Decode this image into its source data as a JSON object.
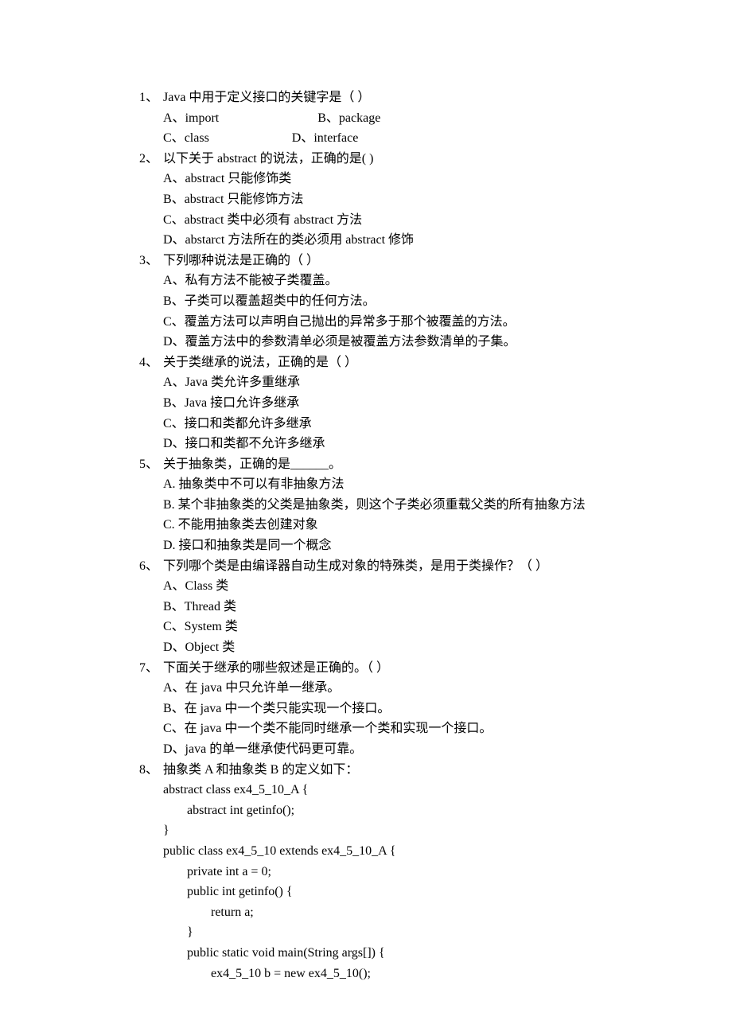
{
  "questions": [
    {
      "num": "1、",
      "stem": "Java 中用于定义接口的关键字是（          ）",
      "optLines": [
        [
          {
            "label": "A、",
            "text": "import",
            "pad": 170
          },
          {
            "label": "B、",
            "text": "package",
            "pad": 0
          }
        ],
        [
          {
            "label": "C、",
            "text": "class",
            "pad": 130
          },
          {
            "label": "D、",
            "text": "interface",
            "pad": 0
          }
        ]
      ]
    },
    {
      "num": "2、",
      "stem": "以下关于 abstract 的说法，正确的是(           )",
      "options": [
        "A、abstract 只能修饰类",
        "B、abstract 只能修饰方法",
        "C、abstract 类中必须有 abstract 方法",
        "D、abstarct 方法所在的类必须用 abstract 修饰"
      ]
    },
    {
      "num": "3、",
      "stem": "下列哪种说法是正确的（          ）",
      "options": [
        "A、私有方法不能被子类覆盖。",
        "B、子类可以覆盖超类中的任何方法。",
        "C、覆盖方法可以声明自己抛出的异常多于那个被覆盖的方法。",
        "D、覆盖方法中的参数清单必须是被覆盖方法参数清单的子集。"
      ]
    },
    {
      "num": "4、",
      "stem": "关于类继承的说法，正确的是（         ）",
      "options": [
        "A、Java  类允许多重继承",
        "B、Java 接口允许多继承",
        "C、接口和类都允许多继承",
        "D、接口和类都不允许多继承"
      ]
    },
    {
      "num": "5、",
      "stem": "关于抽象类，正确的是______。",
      "options": [
        "A. 抽象类中不可以有非抽象方法",
        "B. 某个非抽象类的父类是抽象类，则这个子类必须重载父类的所有抽象方法",
        "C. 不能用抽象类去创建对象",
        "D. 接口和抽象类是同一个概念"
      ]
    },
    {
      "num": "6、",
      "stem": "下列哪个类是由编译器自动生成对象的特殊类，是用于类操作？（         ）",
      "options": [
        "A、Class 类",
        "B、Thread 类",
        "C、System 类",
        "D、Object 类"
      ]
    },
    {
      "num": "7、",
      "stem": "下面关于继承的哪些叙述是正确的。（          ）",
      "options": [
        "A、在 java 中只允许单一继承。",
        "B、在 java 中一个类只能实现一个接口。",
        "C、在 java 中一个类不能同时继承一个类和实现一个接口。",
        "D、java 的单一继承使代码更可靠。"
      ]
    },
    {
      "num": "8、",
      "stem": "抽象类 A 和抽象类 B 的定义如下：",
      "code": [
        {
          "indent": 0,
          "text": "abstract class ex4_5_10_A {"
        },
        {
          "indent": 1,
          "text": "abstract int getinfo();"
        },
        {
          "indent": 0,
          "text": "}"
        },
        {
          "indent": 0,
          "text": "public class ex4_5_10 extends ex4_5_10_A {"
        },
        {
          "indent": 1,
          "text": "private int a = 0;"
        },
        {
          "indent": 1,
          "text": "public int getinfo() {"
        },
        {
          "indent": 2,
          "text": "return a;"
        },
        {
          "indent": 1,
          "text": "}"
        },
        {
          "indent": 1,
          "text": "public static void main(String args[]) {"
        },
        {
          "indent": 2,
          "text": "ex4_5_10 b = new ex4_5_10();"
        }
      ]
    }
  ]
}
